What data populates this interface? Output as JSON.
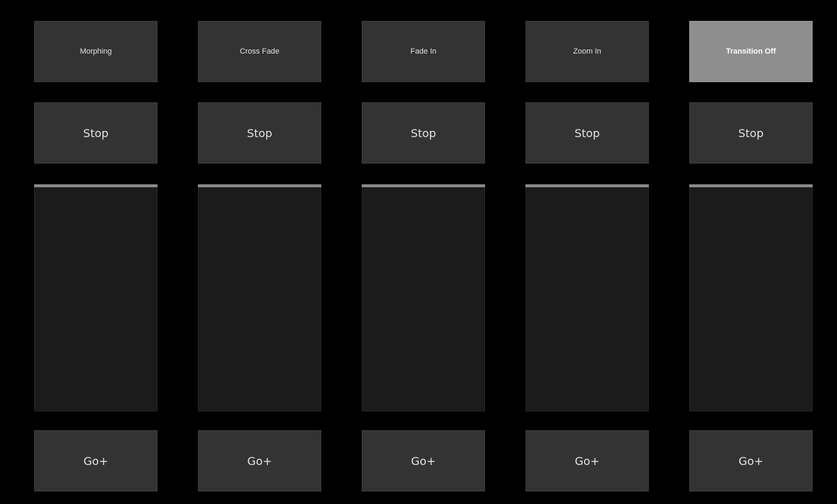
{
  "columns": [
    {
      "mode_label": "Morphing",
      "mode_active": false,
      "stop_label": "Stop",
      "go_label": "Go+",
      "fader_level": 1.0
    },
    {
      "mode_label": "Cross Fade",
      "mode_active": false,
      "stop_label": "Stop",
      "go_label": "Go+",
      "fader_level": 1.0
    },
    {
      "mode_label": "Fade In",
      "mode_active": false,
      "stop_label": "Stop",
      "go_label": "Go+",
      "fader_level": 1.0
    },
    {
      "mode_label": "Zoom In",
      "mode_active": false,
      "stop_label": "Stop",
      "go_label": "Go+",
      "fader_level": 1.0
    },
    {
      "mode_label": "Transition Off",
      "mode_active": true,
      "stop_label": "Stop",
      "go_label": "Go+",
      "fader_level": 1.0
    }
  ],
  "colors": {
    "background": "#000000",
    "button": "#333333",
    "button_active": "#8e8e8e",
    "fader_track": "#1b1b1b",
    "fader_handle": "#8a8a8a"
  }
}
